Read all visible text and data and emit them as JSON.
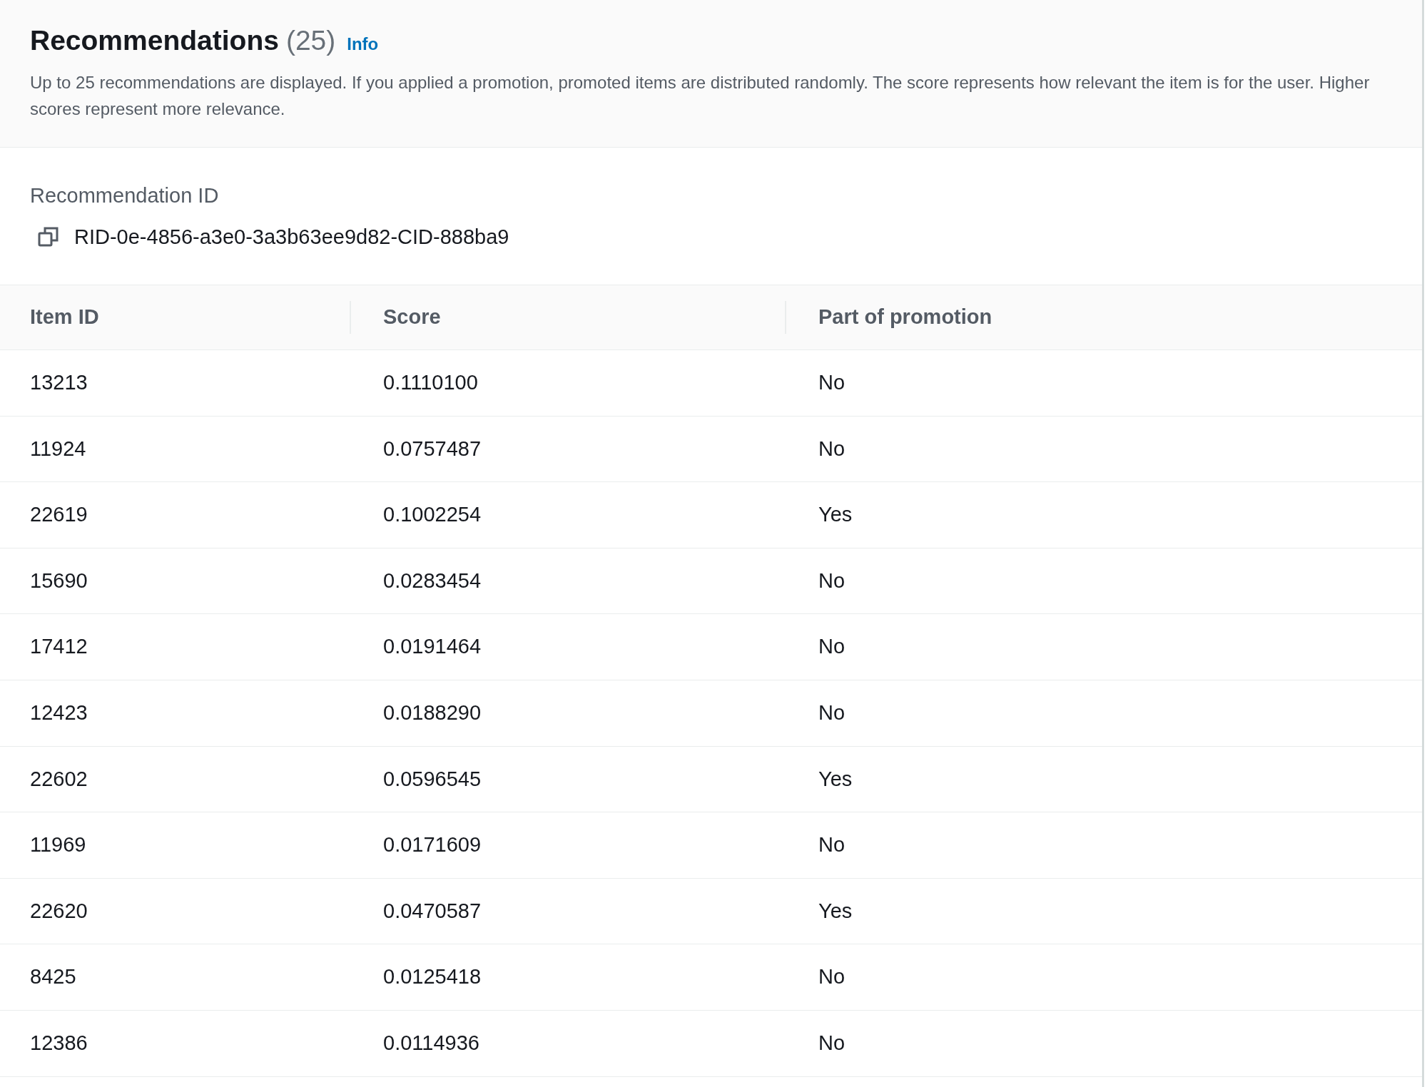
{
  "header": {
    "title": "Recommendations",
    "count": "(25)",
    "info_link": "Info",
    "description": "Up to 25 recommendations are displayed. If you applied a promotion, promoted items are distributed randomly. The score represents how relevant the item is for the user. Higher scores represent more relevance."
  },
  "recommendation_id": {
    "label": "Recommendation ID",
    "value": "RID-0e-4856-a3e0-3a3b63ee9d82-CID-888ba9"
  },
  "table": {
    "columns": [
      "Item ID",
      "Score",
      "Part of promotion"
    ],
    "rows": [
      [
        "13213",
        "0.1110100",
        "No"
      ],
      [
        "11924",
        "0.0757487",
        "No"
      ],
      [
        "22619",
        "0.1002254",
        "Yes"
      ],
      [
        "15690",
        "0.0283454",
        "No"
      ],
      [
        "17412",
        "0.0191464",
        "No"
      ],
      [
        "12423",
        "0.0188290",
        "No"
      ],
      [
        "22602",
        "0.0596545",
        "Yes"
      ],
      [
        "11969",
        "0.0171609",
        "No"
      ],
      [
        "22620",
        "0.0470587",
        "Yes"
      ],
      [
        "8425",
        "0.0125418",
        "No"
      ],
      [
        "12386",
        "0.0114936",
        "No"
      ]
    ]
  }
}
